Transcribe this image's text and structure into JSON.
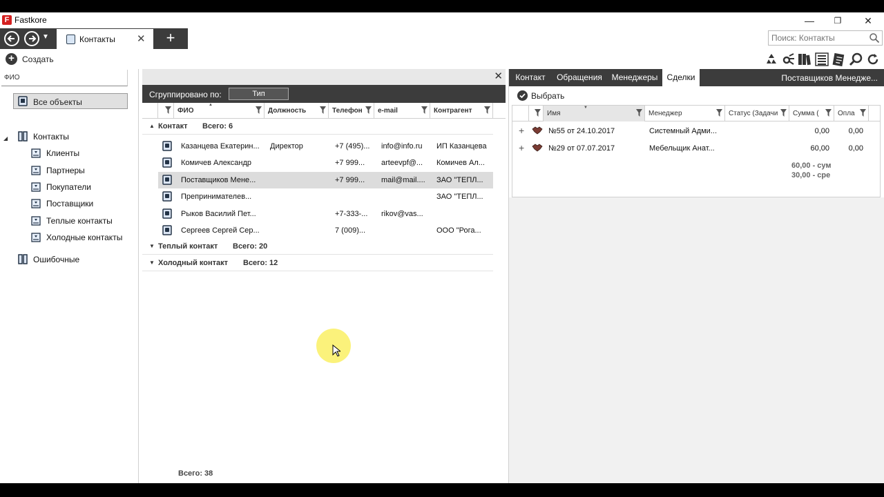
{
  "app": {
    "title": "Fastkore",
    "logo_letter": "F"
  },
  "window": {
    "minimize": "—",
    "maximize": "❐",
    "close": "✕"
  },
  "tabbar": {
    "active_tab": "Контакты",
    "close_glyph": "✕",
    "add_glyph": "+",
    "search_placeholder": "Поиск: Контакты"
  },
  "toolbar": {
    "create_label": "Создать",
    "icons": [
      "recycle-icon",
      "sync-settings-icon",
      "books-icon",
      "list-view-icon",
      "report-icon",
      "search-zoom-icon",
      "refresh-icon"
    ]
  },
  "left": {
    "search_value": "ФИО",
    "all_objects": "Все объекты",
    "tree": [
      {
        "label": "Контакты",
        "level": 0,
        "type": "folder"
      },
      {
        "label": "Клиенты",
        "level": 1,
        "type": "filter"
      },
      {
        "label": "Партнеры",
        "level": 1,
        "type": "filter"
      },
      {
        "label": "Покупатели",
        "level": 1,
        "type": "filter"
      },
      {
        "label": "Поставщики",
        "level": 1,
        "type": "filter"
      },
      {
        "label": "Теплые контакты",
        "level": 1,
        "type": "filter"
      },
      {
        "label": "Холодные контакты",
        "level": 1,
        "type": "filter"
      },
      {
        "label": "Ошибочные",
        "level": 0,
        "type": "folder"
      }
    ]
  },
  "middle": {
    "close_glyph": "✕",
    "grouped_by_label": "Сгруппировано по:",
    "group_chip": "Тип",
    "columns": [
      "ФИО",
      "Должность",
      "Телефон",
      "e-mail",
      "Контрагент"
    ],
    "groups": [
      {
        "name": "Контакт",
        "count": "Всего: 6",
        "expanded": true,
        "rows": [
          {
            "name": "Казанцева Екатерин...",
            "position": "Директор",
            "phone": "+7 (495)...",
            "email": "info@info.ru",
            "company": "ИП Казанцева"
          },
          {
            "name": "Комичев Александр",
            "position": "",
            "phone": "+7 999...",
            "email": "arteevpf@...",
            "company": "Комичев Ал..."
          },
          {
            "name": "Поставщиков Мене...",
            "position": "",
            "phone": "+7 999...",
            "email": "mail@mail....",
            "company": "ЗАО \"ТЕПЛ...",
            "selected": true
          },
          {
            "name": "Препринимателев...",
            "position": "",
            "phone": "",
            "email": "",
            "company": "ЗАО \"ТЕПЛ..."
          },
          {
            "name": "Рыков Василий Пет...",
            "position": "",
            "phone": "+7-333-...",
            "email": "rikov@vas...",
            "company": ""
          },
          {
            "name": "Сергеев Сергей Сер...",
            "position": "",
            "phone": "7 (009)...",
            "email": "",
            "company": "ООО \"Рога..."
          }
        ]
      },
      {
        "name": "Теплый контакт",
        "count": "Всего: 20",
        "expanded": false
      },
      {
        "name": "Холодный контакт",
        "count": "Всего: 12",
        "expanded": false
      }
    ],
    "footer_total": "Всего: 38"
  },
  "right": {
    "tabs": [
      "Контакт",
      "Обращения",
      "Менеджеры",
      "Сделки"
    ],
    "active_tab": "Сделки",
    "record_title": "Поставщиков Менедже...",
    "select_label": "Выбрать",
    "columns": [
      "Имя",
      "Менеджер",
      "Статус (Задачи",
      "Сумма (",
      "Опла"
    ],
    "deals": [
      {
        "name": "№55 от 24.10.2017",
        "manager": "Системный Адми...",
        "status": "",
        "sum": "0,00",
        "paid": "0,00"
      },
      {
        "name": "№29 от 07.07.2017",
        "manager": "Мебельщик Анат...",
        "status": "",
        "sum": "60,00",
        "paid": "0,00"
      }
    ],
    "total_sum": "60,00 - сум",
    "avg_sum": "30,00 - сре"
  },
  "colors": {
    "dark_bar": "#3c3c3c",
    "selected_row": "#dcdcdc",
    "cursor_highlight": "#faf064",
    "logo_red": "#d42020"
  }
}
